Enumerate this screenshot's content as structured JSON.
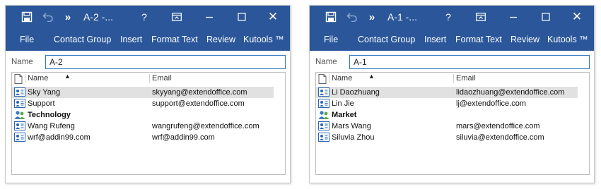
{
  "colors": {
    "title_bar": "#2b579a",
    "selection": "#e1e1e1",
    "input_border": "#2b79c2"
  },
  "windows": [
    {
      "title": "A-2 -...",
      "title_controls": {
        "more": "»",
        "help": "?",
        "close": "✕"
      },
      "menu": [
        "File",
        "Contact Group",
        "Insert",
        "Format Text",
        "Review",
        "Kutools ™"
      ],
      "name_label": "Name",
      "name_value": "A-2",
      "columns": {
        "name": "Name",
        "email": "Email"
      },
      "rows": [
        {
          "name": "Sky Yang",
          "email": "skyyang@extendoffice.com",
          "type": "contact",
          "selected": true
        },
        {
          "name": "Support",
          "email": "support@extendoffice.com",
          "type": "contact",
          "selected": false
        },
        {
          "name": "Technology",
          "email": "",
          "type": "group",
          "selected": false
        },
        {
          "name": "Wang Rufeng",
          "email": "wangrufeng@extendoffice.com",
          "type": "contact",
          "selected": false
        },
        {
          "name": "wrf@addin99.com",
          "email": "wrf@addin99.com",
          "type": "contact",
          "selected": false
        }
      ]
    },
    {
      "title": "A-1 -...",
      "title_controls": {
        "more": "»",
        "help": "?",
        "close": "✕"
      },
      "menu": [
        "File",
        "Contact Group",
        "Insert",
        "Format Text",
        "Review",
        "Kutools ™"
      ],
      "name_label": "Name",
      "name_value": "A-1",
      "columns": {
        "name": "Name",
        "email": "Email"
      },
      "rows": [
        {
          "name": "Li Daozhuang",
          "email": "lidaozhuang@extendoffice.com",
          "type": "contact",
          "selected": true
        },
        {
          "name": "Lin Jie",
          "email": "lj@extendoffice.com",
          "type": "contact",
          "selected": false
        },
        {
          "name": "Market",
          "email": "",
          "type": "group",
          "selected": false
        },
        {
          "name": "Mars Wang",
          "email": "mars@extendoffice.com",
          "type": "contact",
          "selected": false
        },
        {
          "name": "Siluvia Zhou",
          "email": "siluvia@extendoffice.com",
          "type": "contact",
          "selected": false
        }
      ]
    }
  ]
}
